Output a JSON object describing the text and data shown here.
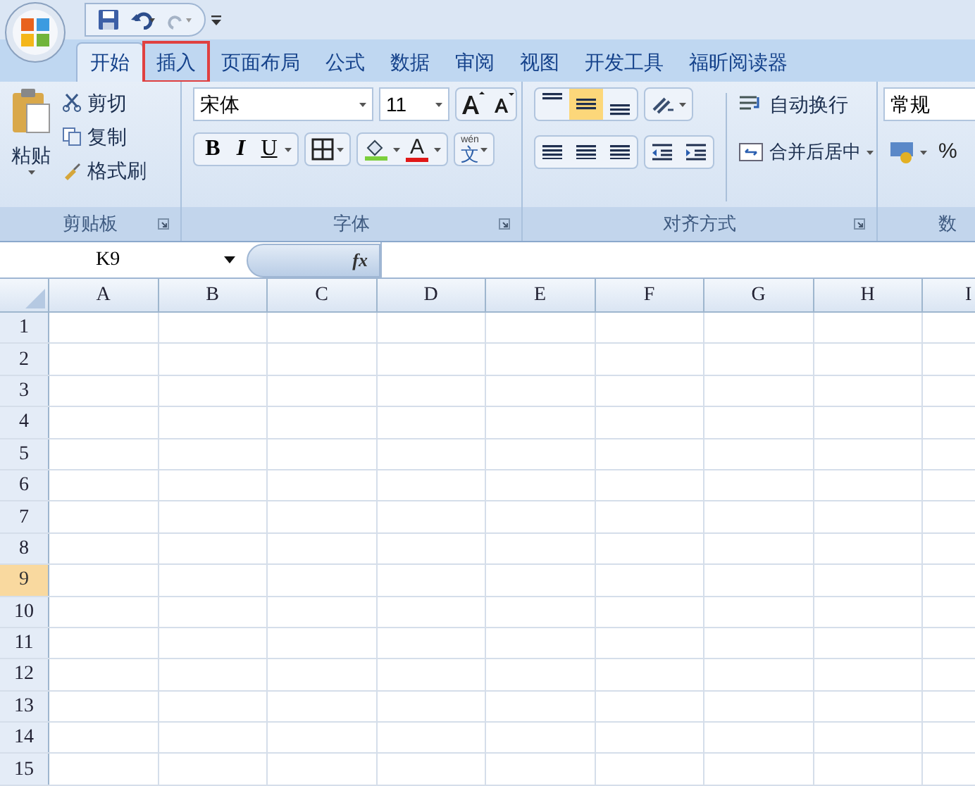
{
  "tabs": [
    {
      "label": "开始",
      "selected": true,
      "annotated": false
    },
    {
      "label": "插入",
      "selected": false,
      "annotated": true
    },
    {
      "label": "页面布局",
      "selected": false,
      "annotated": false
    },
    {
      "label": "公式",
      "selected": false,
      "annotated": false
    },
    {
      "label": "数据",
      "selected": false,
      "annotated": false
    },
    {
      "label": "审阅",
      "selected": false,
      "annotated": false
    },
    {
      "label": "视图",
      "selected": false,
      "annotated": false
    },
    {
      "label": "开发工具",
      "selected": false,
      "annotated": false
    },
    {
      "label": "福昕阅读器",
      "selected": false,
      "annotated": false
    }
  ],
  "clipboard": {
    "paste": "粘贴",
    "cut": "剪切",
    "copy": "复制",
    "format_painter": "格式刷",
    "group": "剪贴板"
  },
  "font": {
    "name": "宋体",
    "size": "11",
    "bold": "B",
    "italic": "I",
    "underline": "U",
    "font_color": "A",
    "phonetic_ruby": "wén",
    "phonetic_char": "文",
    "group": "字体"
  },
  "alignment": {
    "vertical": [
      {
        "kind": "top",
        "selected": false
      },
      {
        "kind": "middle",
        "selected": true
      },
      {
        "kind": "bottom",
        "selected": false
      }
    ],
    "wrap": "自动换行",
    "merge": "合并后居中",
    "group": "对齐方式"
  },
  "number": {
    "format": "常规",
    "percent": "%",
    "group": "数"
  },
  "formula_bar": {
    "name_box": "K9",
    "fx": "fx"
  },
  "columns": [
    "A",
    "B",
    "C",
    "D",
    "E",
    "F",
    "G",
    "H",
    "I"
  ],
  "rows": [
    {
      "label": "1",
      "selected": false
    },
    {
      "label": "2",
      "selected": false
    },
    {
      "label": "3",
      "selected": false
    },
    {
      "label": "4",
      "selected": false
    },
    {
      "label": "5",
      "selected": false
    },
    {
      "label": "6",
      "selected": false
    },
    {
      "label": "7",
      "selected": false
    },
    {
      "label": "8",
      "selected": false
    },
    {
      "label": "9",
      "selected": true
    },
    {
      "label": "10",
      "selected": false
    },
    {
      "label": "11",
      "selected": false
    },
    {
      "label": "12",
      "selected": false
    },
    {
      "label": "13",
      "selected": false
    },
    {
      "label": "14",
      "selected": false
    },
    {
      "label": "15",
      "selected": false
    }
  ]
}
